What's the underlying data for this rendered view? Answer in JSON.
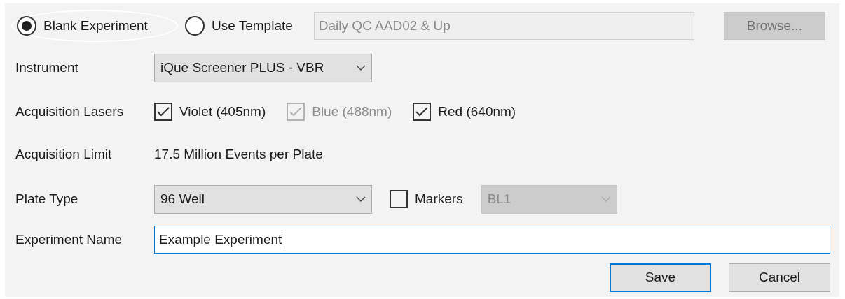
{
  "source": {
    "options": [
      {
        "label": "Blank Experiment",
        "selected": true,
        "focused": true
      },
      {
        "label": "Use Template",
        "selected": false,
        "focused": false
      }
    ],
    "template_field": {
      "value": "Daily QC AAD02 & Up",
      "disabled": true
    },
    "browse_button": {
      "label": "Browse...",
      "disabled": true
    }
  },
  "instrument": {
    "label": "Instrument",
    "value": "iQue Screener PLUS - VBR",
    "disabled": false
  },
  "lasers": {
    "label": "Acquisition Lasers",
    "items": [
      {
        "label": "Violet (405nm)",
        "checked": true,
        "disabled": false
      },
      {
        "label": "Blue (488nm)",
        "checked": true,
        "disabled": true
      },
      {
        "label": "Red (640nm)",
        "checked": true,
        "disabled": false
      }
    ]
  },
  "limit": {
    "label": "Acquisition Limit",
    "value": "17.5 Million Events per Plate"
  },
  "plate_type": {
    "label": "Plate Type",
    "value": "96 Well",
    "disabled": false
  },
  "markers": {
    "label": "Markers",
    "checked": false,
    "disabled": false,
    "dropdown": {
      "value": "BL1",
      "disabled": true
    }
  },
  "experiment_name": {
    "label": "Experiment Name",
    "value": "Example Experiment",
    "focused": true
  },
  "buttons": [
    {
      "label": "Save",
      "default": true
    },
    {
      "label": "Cancel",
      "default": false
    }
  ]
}
